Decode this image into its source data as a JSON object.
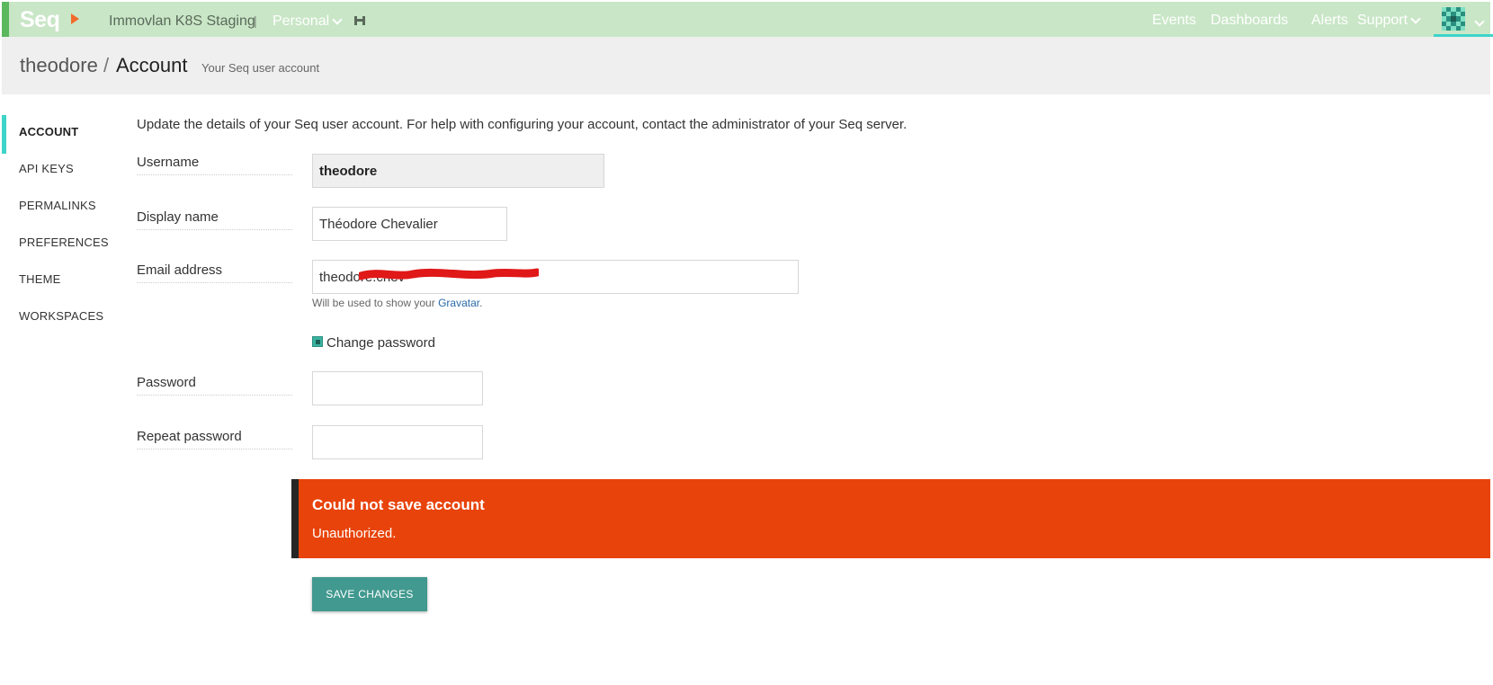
{
  "topbar": {
    "logo": "Seq",
    "instance_name": "Immovlan K8S Staging",
    "separator": "|",
    "workspace": "Personal",
    "nav": {
      "events": "Events",
      "dashboards": "Dashboards",
      "alerts": "Alerts",
      "support": "Support"
    }
  },
  "header": {
    "user": "theodore",
    "separator": "/",
    "page": "Account",
    "description": "Your Seq user account"
  },
  "sidebar": {
    "items": [
      {
        "label": "ACCOUNT",
        "active": true
      },
      {
        "label": "API KEYS"
      },
      {
        "label": "PERMALINKS"
      },
      {
        "label": "PREFERENCES"
      },
      {
        "label": "THEME"
      },
      {
        "label": "WORKSPACES"
      }
    ]
  },
  "form": {
    "intro": "Update the details of your Seq user account. For help with configuring your account, contact the administrator of your Seq server.",
    "username_label": "Username",
    "username_value": "theodore",
    "display_name_label": "Display name",
    "display_name_value": "Théodore Chevalier",
    "email_label": "Email address",
    "email_value": "theodore.chev",
    "email_hint_prefix": "Will be used to show your ",
    "email_hint_link": "Gravatar",
    "email_hint_suffix": ".",
    "change_password_label": "Change password",
    "change_password_checked": true,
    "password_label": "Password",
    "repeat_password_label": "Repeat password"
  },
  "alert": {
    "title": "Could not save account",
    "message": "Unauthorized."
  },
  "save_button": "SAVE CHANGES",
  "colors": {
    "topbar_bg": "#c9e6c7",
    "brand_green": "#5bb85d",
    "accent_teal": "#3ed4c9",
    "alert_bg": "#e8430a",
    "button_bg": "#41998f"
  }
}
